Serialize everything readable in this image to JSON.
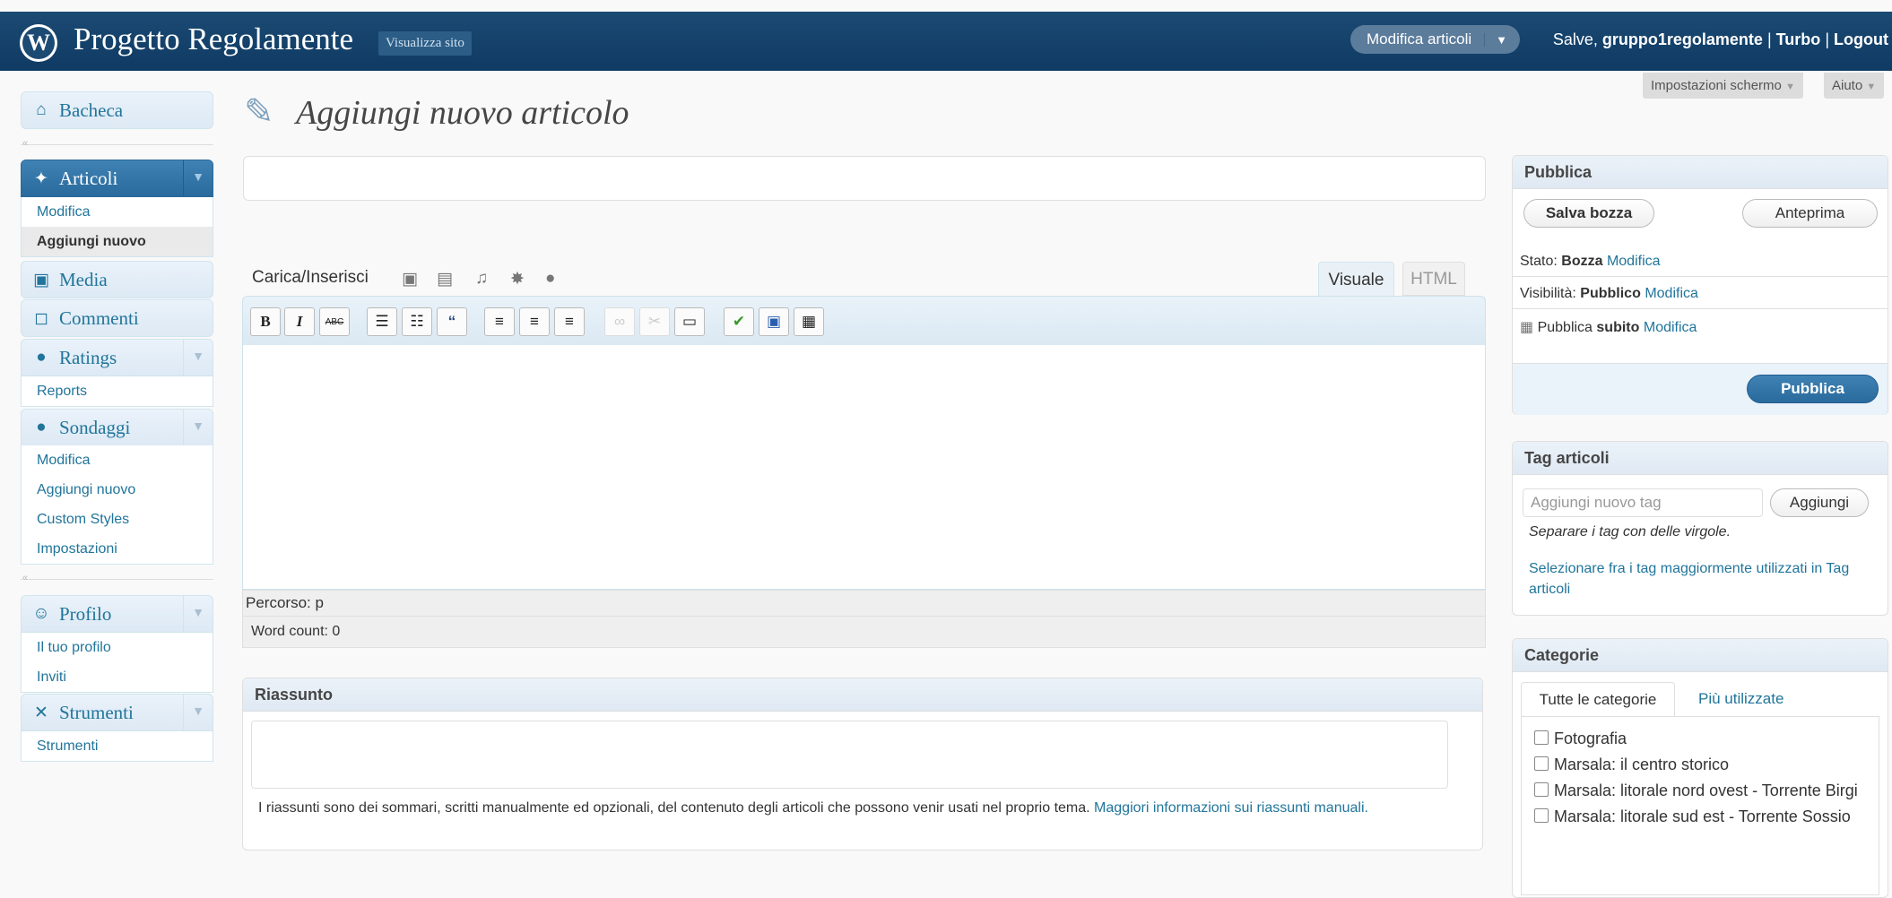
{
  "header": {
    "logo": "wordpress-logo",
    "site_title": "Progetto Regolamente",
    "view_site": "Visualizza sito",
    "favorite_action": "Modifica articoli",
    "greeting": "Salve,",
    "username": "gruppo1regolamente",
    "turbo": "Turbo",
    "logout": "Logout",
    "separator": "|"
  },
  "screen_options": "Impostazioni schermo",
  "help": "Aiuto",
  "sidebar": {
    "dashboard": "Bacheca",
    "posts": {
      "label": "Articoli",
      "items": [
        "Modifica",
        "Aggiungi nuovo"
      ]
    },
    "media": "Media",
    "comments": "Commenti",
    "ratings": {
      "label": "Ratings",
      "items": [
        "Reports"
      ]
    },
    "polls": {
      "label": "Sondaggi",
      "items": [
        "Modifica",
        "Aggiungi nuovo",
        "Custom Styles",
        "Impostazioni"
      ]
    },
    "profile": {
      "label": "Profilo",
      "items": [
        "Il tuo profilo",
        "Inviti"
      ]
    },
    "tools": {
      "label": "Strumenti",
      "items": [
        "Strumenti"
      ]
    }
  },
  "main": {
    "title": "Aggiungi nuovo articolo",
    "title_value": "",
    "upload_insert": "Carica/Inserisci",
    "tab_visual": "Visuale",
    "tab_html": "HTML",
    "path_label": "Percorso: p",
    "word_count": "Word count: 0",
    "excerpt": {
      "title": "Riassunto",
      "help_text": "I riassunti sono dei sommari, scritti manualmente ed opzionali, del contenuto degli articoli che possono venir usati nel proprio tema.",
      "help_link": "Maggiori informazioni sui riassunti manuali."
    }
  },
  "publish": {
    "title": "Pubblica",
    "save_draft": "Salva bozza",
    "preview": "Anteprima",
    "status_label": "Stato:",
    "status_value": "Bozza",
    "visibility_label": "Visibilità:",
    "visibility_value": "Pubblico",
    "publish_label": "Pubblica",
    "publish_value": "subito",
    "edit_link": "Modifica",
    "publish_button": "Pubblica"
  },
  "tags": {
    "title": "Tag articoli",
    "placeholder": "Aggiungi nuovo tag",
    "add_button": "Aggiungi",
    "hint": "Separare i tag con delle virgole.",
    "choose_link": "Selezionare fra i tag maggiormente utilizzati in Tag articoli"
  },
  "categories": {
    "title": "Categorie",
    "tab_all": "Tutte le categorie",
    "tab_popular": "Più utilizzate",
    "items": [
      "Fotografia",
      "Marsala: il centro storico",
      "Marsala: litorale nord ovest - Torrente Birgi",
      "Marsala: litorale sud est - Torrente Sossio"
    ]
  },
  "colors": {
    "header": "#0f3a63",
    "accent": "#21759b",
    "primary_button": "#2a6a9c"
  }
}
